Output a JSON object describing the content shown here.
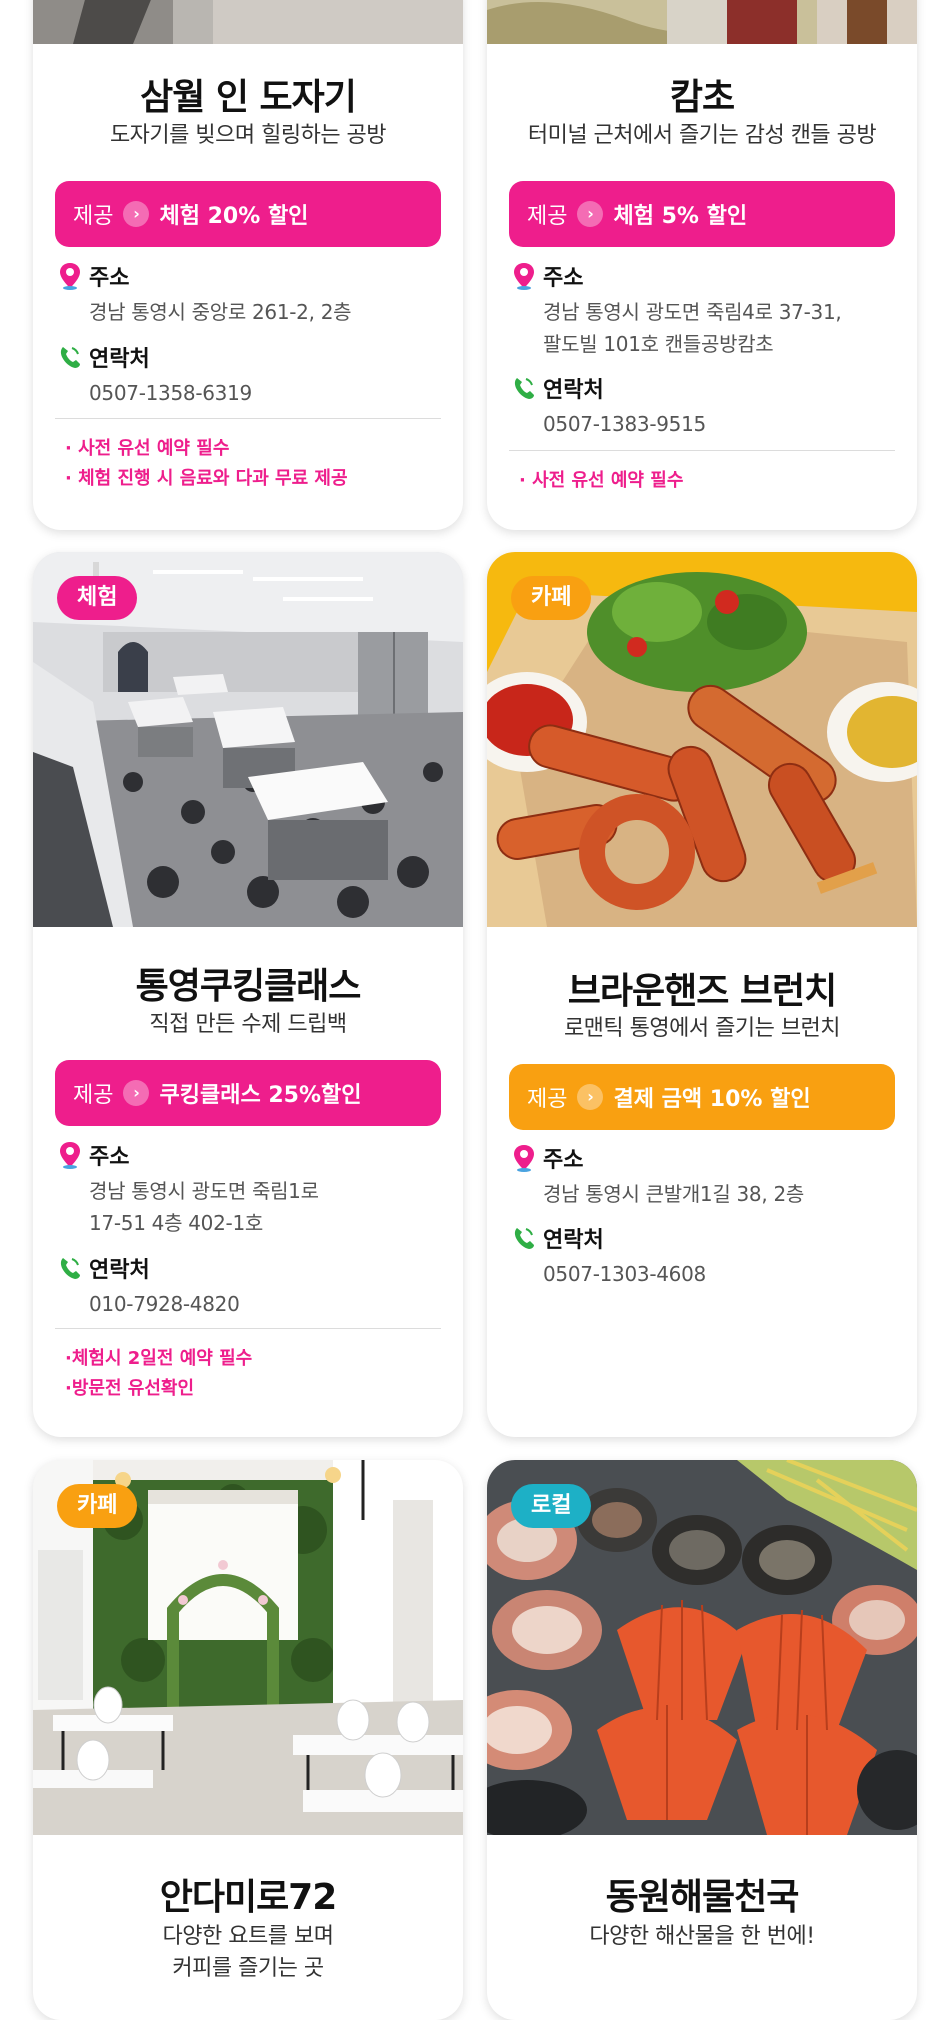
{
  "cards": [
    {
      "title": "삼월 인 도자기",
      "subtitle": "도자기를 빚으며 힐링하는 공방",
      "offer_label": "제공",
      "offer_text": "체험 20% 할인",
      "address_label": "주소",
      "address": "경남 통영시 중앙로 261-2, 2층",
      "contact_label": "연락처",
      "contact": "0507-1358-6319",
      "notes": [
        "· 사전 유선 예약 필수",
        "· 체험 진행 시 음료와 다과 무료 제공"
      ]
    },
    {
      "title": "캄초",
      "subtitle": "터미널 근처에서 즐기는 감성 캔들 공방",
      "offer_label": "제공",
      "offer_text": "체험 5% 할인",
      "address_label": "주소",
      "address_line1": "경남 통영시 광도면 죽림4로 37-31,",
      "address_line2": "팔도빌 101호 캔들공방캄초",
      "contact_label": "연락처",
      "contact": "0507-1383-9515",
      "notes": [
        "· 사전 유선 예약 필수"
      ]
    },
    {
      "badge": "체험",
      "title": "통영쿠킹클래스",
      "subtitle": "직접 만든 수제 드립백",
      "offer_label": "제공",
      "offer_text": "쿠킹클래스 25%할인",
      "address_label": "주소",
      "address_line1": "경남 통영시 광도면 죽림1로",
      "address_line2": "17-51 4층 402-1호",
      "contact_label": "연락처",
      "contact": "010-7928-4820",
      "notes": [
        "·체험시 2일전 예약 필수",
        "·방문전 유선확인"
      ]
    },
    {
      "badge": "카페",
      "title": "브라운핸즈 브런치",
      "subtitle": "로맨틱 통영에서 즐기는 브런치",
      "offer_label": "제공",
      "offer_text": "결제 금액 10% 할인",
      "address_label": "주소",
      "address": "경남 통영시 큰발개1길 38, 2층",
      "contact_label": "연락처",
      "contact": "0507-1303-4608"
    },
    {
      "badge": "카페",
      "title": "안다미로72",
      "subtitle_line1": "다양한 요트를 보며",
      "subtitle_line2": "커피를 즐기는 곳"
    },
    {
      "badge": "로컬",
      "title": "동원해물천국",
      "subtitle": "다양한 해산물을 한 번에!"
    }
  ],
  "icons": {
    "address": "map-pin-icon",
    "contact": "phone-icon",
    "offer_arrow": "chevron-right-icon"
  },
  "colors": {
    "pink": "#ee1e8c",
    "orange": "#f9a011",
    "teal": "#1db0c6"
  }
}
